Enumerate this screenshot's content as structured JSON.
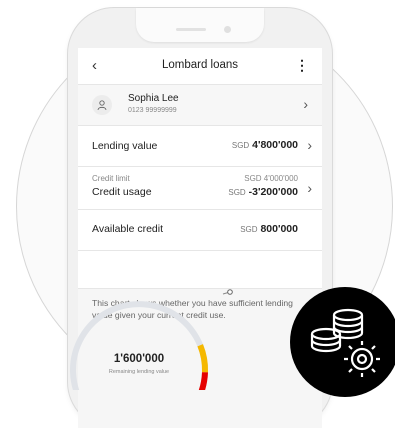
{
  "header": {
    "title": "Lombard loans",
    "back_icon": "chevron-left-icon",
    "menu_icon": "kebab-menu-icon"
  },
  "profile": {
    "name": "Sophia Lee",
    "phone": "0123 99999999",
    "avatar_icon": "user-icon"
  },
  "rows": {
    "lending": {
      "label": "Lending value",
      "currency": "SGD",
      "value": "4'800'000"
    },
    "credit": {
      "sub_label": "Credit limit",
      "sub_value": "SGD 4'000'000",
      "label": "Credit usage",
      "currency": "SGD",
      "value": "-3'200'000"
    },
    "available": {
      "label": "Available credit",
      "currency": "SGD",
      "value": "800'000"
    }
  },
  "note": {
    "text": "This chart shows whether you have sufficient lending value given your current credit use."
  },
  "gauge": {
    "value": "1'600'000",
    "caption": "Remaining lending value",
    "colors": {
      "track": "#e0e3e8",
      "yellow": "#f5b800",
      "red": "#e60000"
    }
  },
  "badge": {
    "icon": "coins-gear-icon"
  }
}
